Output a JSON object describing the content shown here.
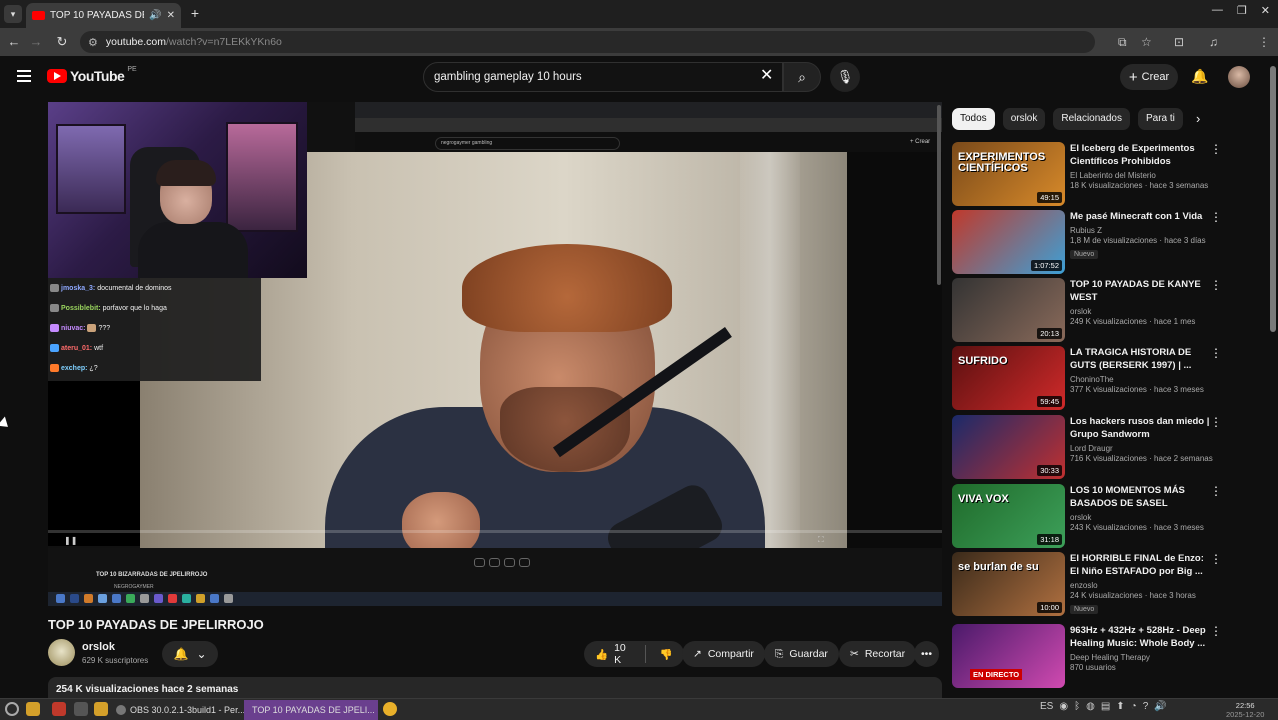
{
  "browser": {
    "tab_title": "TOP 10 PAYADAS DE JP...",
    "url_host": "youtube.com",
    "url_path": "/watch?v=n7LEKkYKn6o"
  },
  "youtube": {
    "country_code": "PE",
    "logo_text": "YouTube",
    "search_value": "gambling gameplay 10 hours",
    "create_label": "Crear"
  },
  "stream": {
    "inner_search": "negrogaymer gambling",
    "inner_create": "+ Crear",
    "chat": [
      {
        "user": "jmoska_3:",
        "msg": "documental de dominos",
        "color": "#8ea8ff"
      },
      {
        "user": "Possiblebit:",
        "msg": "porfavor que lo haga",
        "color": "#9ad55e"
      },
      {
        "user": "niuvac:",
        "msg": "???",
        "color": "#c58bff"
      },
      {
        "user": "ateru_01:",
        "msg": "wtf",
        "color": "#ff6b6b"
      },
      {
        "user": "exchep:",
        "msg": "¿?",
        "color": "#7fd0ff"
      }
    ],
    "inner_video_title": "TOP 10 BIZARRADAS DE JPELIRROJO",
    "inner_channel": "NEGROGAYMER"
  },
  "video": {
    "title": "TOP 10 PAYADAS DE JPELIRROJO",
    "channel": "orslok",
    "subscribers": "629 K suscriptores",
    "likes": "10 K",
    "share_label": "Compartir",
    "save_label": "Guardar",
    "clip_label": "Recortar",
    "views_date": "254 K visualizaciones  hace 2 semanas"
  },
  "chips": [
    "Todos",
    "orslok",
    "Relacionados",
    "Para ti"
  ],
  "recommendations": [
    {
      "title": "El Iceberg de Experimentos Científicos Prohibidos",
      "channel": "El Laberinto del Misterio",
      "meta": "18 K visualizaciones · hace 3 semanas",
      "duration": "49:15",
      "thumb_text": "EXPERIMENTOS CIENTÍFICOS",
      "colors": [
        "#7a4a1a",
        "#d88a2a"
      ]
    },
    {
      "title": "Me pasé Minecraft con 1 Vida",
      "channel": "Rubius Z",
      "meta": "1,8 M de visualizaciones · hace 3 días",
      "duration": "1:07:52",
      "badge": "Nuevo",
      "thumb_text": "",
      "colors": [
        "#c0392b",
        "#3da0d6"
      ]
    },
    {
      "title": "TOP 10 PAYADAS DE KANYE WEST",
      "channel": "orslok",
      "meta": "249 K visualizaciones · hace 1 mes",
      "duration": "20:13",
      "thumb_text": "",
      "colors": [
        "#333",
        "#8a6a5a"
      ]
    },
    {
      "title": "LA TRAGICA HISTORIA DE GUTS (BERSERK 1997) | ...",
      "channel": "ChoninoThe",
      "meta": "377 K visualizaciones · hace 3 meses",
      "duration": "59:45",
      "thumb_text": "SUFRIDO",
      "colors": [
        "#5a1010",
        "#d02a2a"
      ]
    },
    {
      "title": "Los hackers rusos dan miedo | Grupo Sandworm",
      "channel": "Lord Draugr",
      "meta": "716 K visualizaciones · hace 2 semanas",
      "duration": "30:33",
      "thumb_text": "",
      "colors": [
        "#1a2a6a",
        "#c03030"
      ]
    },
    {
      "title": "LOS 10 MOMENTOS MÁS BASADOS DE SASEL",
      "channel": "orslok",
      "meta": "243 K visualizaciones · hace 3 meses",
      "duration": "31:18",
      "thumb_text": "VIVA VOX",
      "colors": [
        "#1f6a2a",
        "#3da05a"
      ]
    },
    {
      "title": "El HORRIBLE FINAL de Enzo: El Niño ESTAFADO por Big ...",
      "channel": "enzoslo",
      "meta": "24 K visualizaciones · hace 3 horas",
      "duration": "10:00",
      "badge": "Nuevo",
      "thumb_text": "se burlan de su",
      "colors": [
        "#3a2a1a",
        "#b07040"
      ]
    },
    {
      "title": "963Hz + 432Hz + 528Hz - Deep Healing Music:  Whole Body ...",
      "channel": "Deep Healing Therapy",
      "meta": "870 usuarios",
      "live": "EN DIRECTO",
      "thumb_text": "",
      "colors": [
        "#4a1a6a",
        "#d04ab0"
      ]
    }
  ],
  "taskbar": {
    "task1": "OBS 30.0.2.1-3build1 - Per...",
    "task2": "TOP 10 PAYADAS DE JPELI...",
    "lang": "ES",
    "time": "22:56",
    "date": "2025-12-20"
  },
  "colors": {
    "accent": "#ff0000",
    "bg": "#0f0f0f",
    "chip": "#272727"
  }
}
